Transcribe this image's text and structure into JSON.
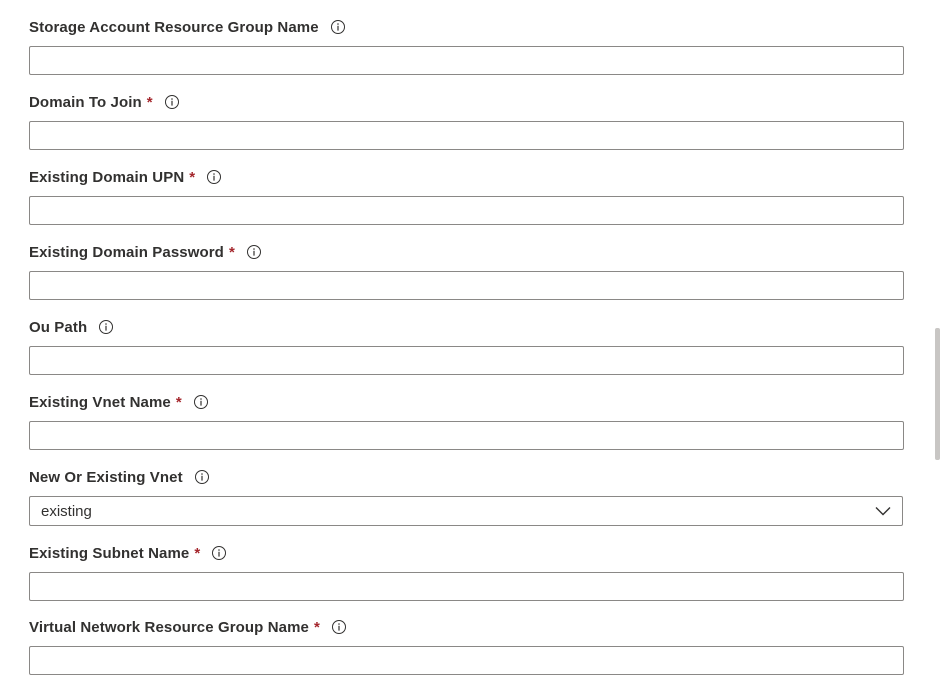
{
  "fields": [
    {
      "label": "Storage Account Resource Group Name",
      "required": false,
      "value": "",
      "type": "text"
    },
    {
      "label": "Domain To Join",
      "required": true,
      "value": "",
      "type": "text"
    },
    {
      "label": "Existing Domain UPN",
      "required": true,
      "value": "",
      "type": "text"
    },
    {
      "label": "Existing Domain Password",
      "required": true,
      "value": "",
      "type": "password"
    },
    {
      "label": "Ou Path",
      "required": false,
      "value": "",
      "type": "text"
    },
    {
      "label": "Existing Vnet Name",
      "required": true,
      "value": "",
      "type": "text"
    },
    {
      "label": "New Or Existing Vnet",
      "required": false,
      "value": "existing",
      "type": "select"
    },
    {
      "label": "Existing Subnet Name",
      "required": true,
      "value": "",
      "type": "text"
    },
    {
      "label": "Virtual Network Resource Group Name",
      "required": true,
      "value": "",
      "type": "text"
    }
  ],
  "required_marker": "*",
  "icons": {
    "info": "info-icon",
    "dropdown": "chevron-down-icon"
  },
  "colors": {
    "label": "#323130",
    "required": "#a4262c",
    "border": "#8a8886",
    "scrollbar_thumb": "#c8c6c4"
  }
}
